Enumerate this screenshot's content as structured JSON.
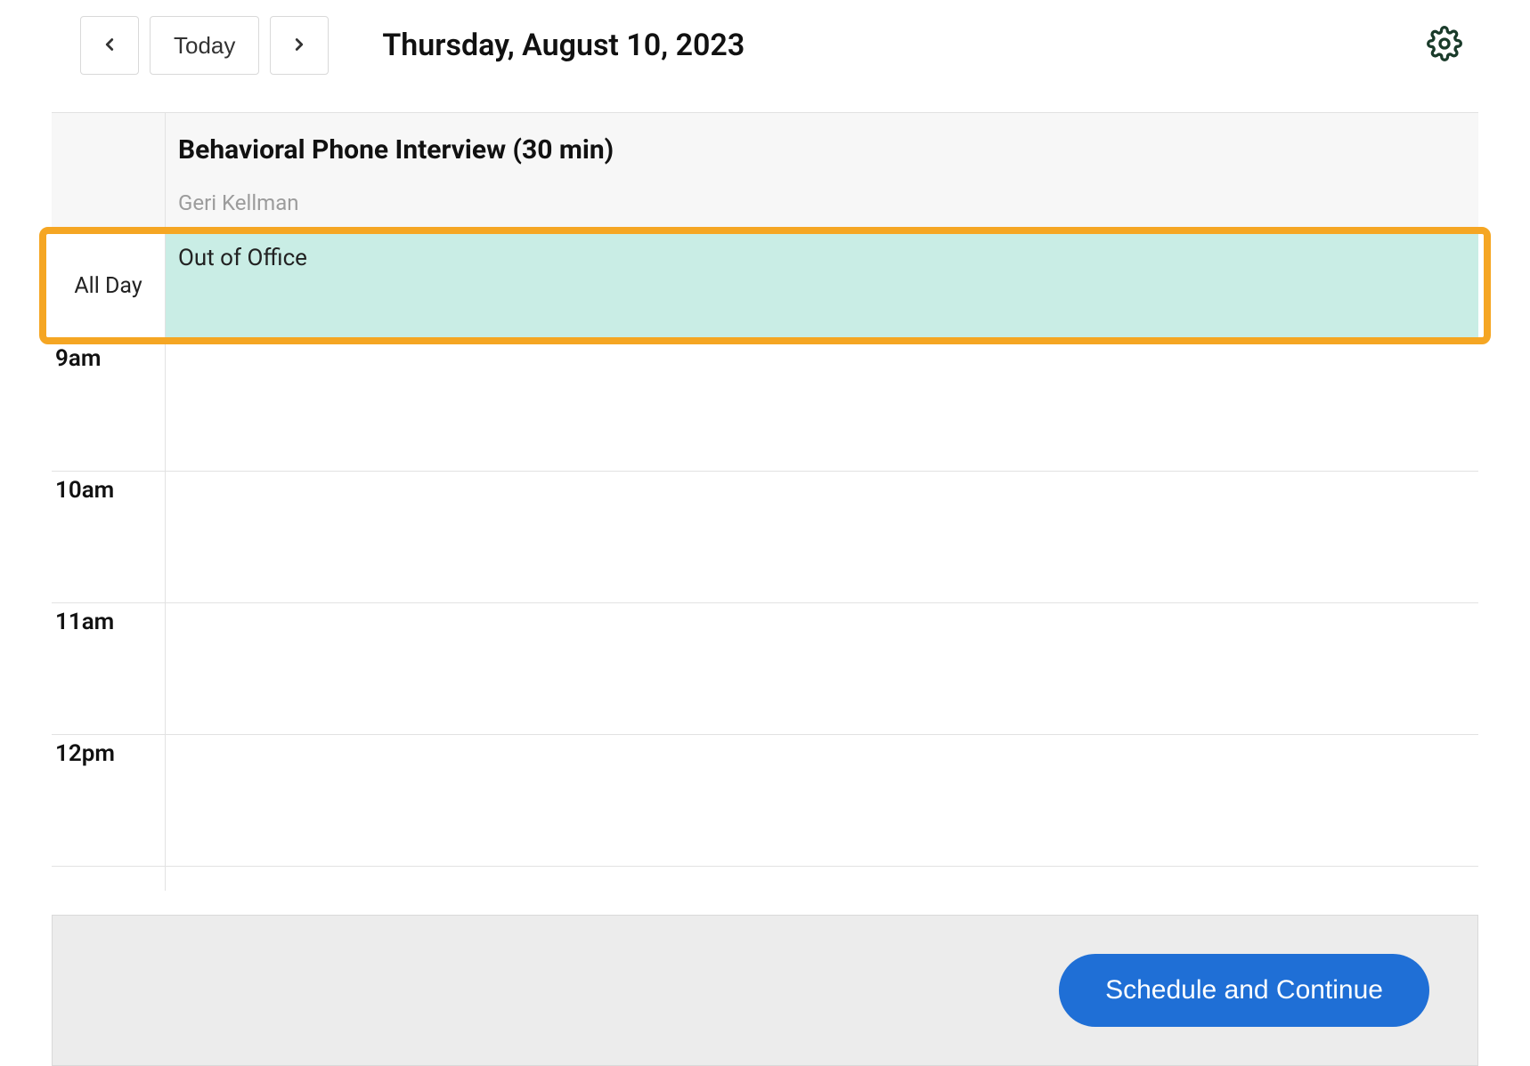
{
  "toolbar": {
    "today_label": "Today",
    "date": "Thursday, August 10, 2023"
  },
  "calendar": {
    "event_title": "Behavioral Phone Interview (30 min)",
    "attendee": "Geri Kellman",
    "allday_label": "All Day",
    "allday_event": "Out of Office",
    "hours": [
      "9am",
      "10am",
      "11am",
      "12pm"
    ]
  },
  "footer": {
    "schedule_label": "Schedule and Continue"
  }
}
